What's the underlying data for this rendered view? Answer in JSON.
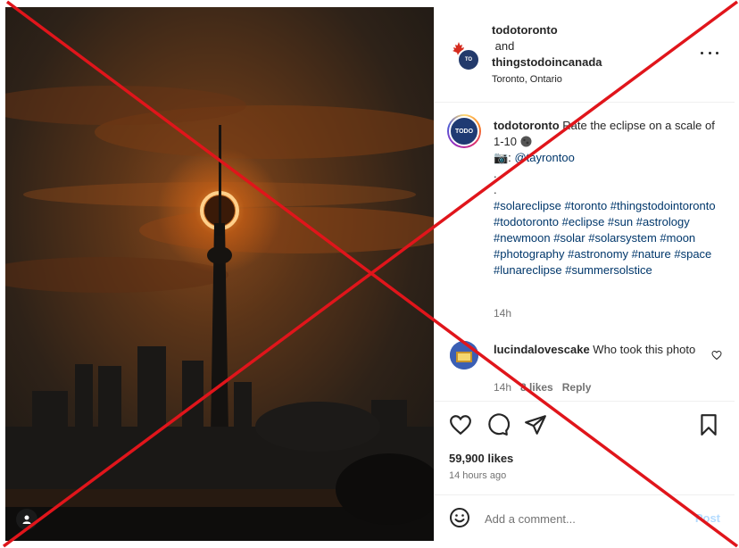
{
  "header": {
    "account1": "todotoronto",
    "and": "and",
    "account2": "thingstodoincanada",
    "location": "Toronto, Ontario",
    "avatar2_text": "TO"
  },
  "caption": {
    "avatar_text": "TODO",
    "username": "todotoronto",
    "text": "Rate the eclipse on a scale of 1-10",
    "camera": "📷:",
    "credit": "@tayrontoo",
    "dot1": ".",
    "dot2": ".",
    "hashtags": "#solareclipse #toronto #thingstodointoronto #todotoronto #eclipse #sun #astrology #newmoon #solar #solarsystem #moon #photography #astronomy #nature #space #lunareclipse #summersolstice",
    "time": "14h"
  },
  "comment": {
    "username": "lucindalovescake",
    "text": "Who took this photo",
    "time": "14h",
    "likes": "8 likes",
    "reply": "Reply"
  },
  "actions": {
    "likes": "59,900 likes",
    "ago": "14 hours ago"
  },
  "add_comment": {
    "placeholder": "Add a comment...",
    "post": "Post"
  },
  "icons": {
    "like": "heart-icon",
    "comment": "comment-bubble-icon",
    "share": "paper-plane-icon",
    "save": "bookmark-icon",
    "emoji": "smiley-icon",
    "more": "more-dots-icon",
    "tagged_user": "user-icon"
  },
  "colors": {
    "link": "#00376b",
    "muted": "#737373",
    "overlay_x": "#e0151b",
    "post_disabled": "#b3dbff"
  }
}
